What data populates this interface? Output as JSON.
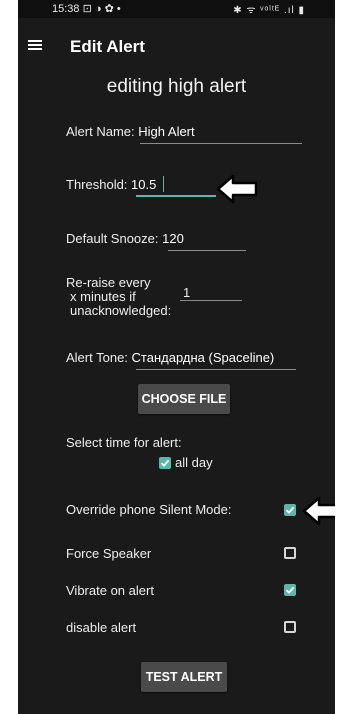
{
  "status_bar": {
    "time": "15:38",
    "left_icons": "⊡ ◑ ✿ •",
    "right_icons": "✱ ᯤ ᵛᵒˡᵗᴱ .ıl ▮"
  },
  "app_bar": {
    "title": "Edit Alert"
  },
  "form": {
    "heading": "editing high alert",
    "alert_name_label": "Alert Name:",
    "alert_name_value": "High Alert",
    "threshold_label": "Threshold:",
    "threshold_value": "10.5",
    "default_snooze_label": "Default Snooze:",
    "default_snooze_value": "120",
    "reraise_label_line1": "Re-raise every",
    "reraise_label_line2": "x minutes if",
    "reraise_label_line3": "unacknowledged:",
    "reraise_value": "1",
    "alert_tone_label": "Alert Tone:",
    "alert_tone_value": "Стандардна (Spaceline)",
    "choose_file_button": "CHOOSE FILE",
    "select_time_label": "Select time for alert:",
    "all_day_label": "all day",
    "all_day_checked": true,
    "override_silent_label": "Override phone Silent Mode:",
    "override_silent_checked": true,
    "force_speaker_label": "Force Speaker",
    "force_speaker_checked": false,
    "vibrate_label": "Vibrate on alert",
    "vibrate_checked": true,
    "disable_alert_label": "disable alert",
    "disable_alert_checked": false,
    "test_alert_button": "TEST ALERT"
  },
  "colors": {
    "background": "#1a1a1a",
    "accent": "#5fb5a9",
    "button": "#4a4a4a"
  }
}
